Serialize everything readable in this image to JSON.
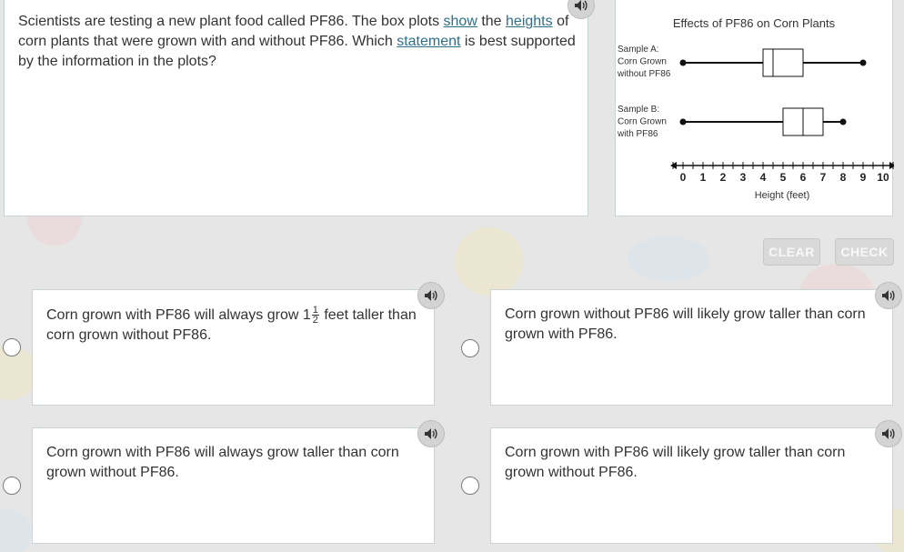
{
  "question": {
    "part1": "Scientists are testing a new plant food called PF86. The box plots ",
    "link_show": "show",
    "part2": " the ",
    "link_heights": "heights",
    "part3": " of corn plants that were grown with and without PF86. Which ",
    "link_statement": "statement",
    "part4": " is best supported by the information in the plots?"
  },
  "chart_data": {
    "type": "boxplot",
    "title": "Effects of PF86 on Corn Plants",
    "xlabel": "Height (feet)",
    "xlim": [
      0,
      10
    ],
    "tick_labels": [
      "0",
      "1",
      "2",
      "3",
      "4",
      "5",
      "6",
      "7",
      "8",
      "9",
      "10"
    ],
    "minor_ticks_per_unit": 2,
    "series": [
      {
        "label_lines": [
          "Sample A:",
          "Corn Grown",
          "without PF86"
        ],
        "min": 0,
        "q1": 4,
        "median": 4.5,
        "q3": 6,
        "max": 9
      },
      {
        "label_lines": [
          "Sample B:",
          "Corn Grown",
          "with PF86"
        ],
        "min": 0,
        "q1": 5,
        "median": 6,
        "q3": 7,
        "max": 8
      }
    ]
  },
  "buttons": {
    "clear": "CLEAR",
    "check": "CHECK"
  },
  "answers": [
    {
      "text_before": "Corn grown with PF86 will always grow 1",
      "frac_num": "1",
      "frac_den": "2",
      "text_after": " feet taller than corn grown without PF86."
    },
    {
      "text": "Corn grown without PF86 will likely grow taller than corn grown with PF86."
    },
    {
      "text": "Corn grown with PF86 will always grow taller than corn grown without PF86."
    },
    {
      "text": "Corn grown with PF86 will likely grow taller than corn grown without PF86."
    }
  ],
  "icons": {
    "audio": "speaker-icon"
  },
  "colors": {
    "link": "#2e6f8a",
    "button_bg": "#d9d9d9",
    "card_border": "#c9d4d6"
  }
}
